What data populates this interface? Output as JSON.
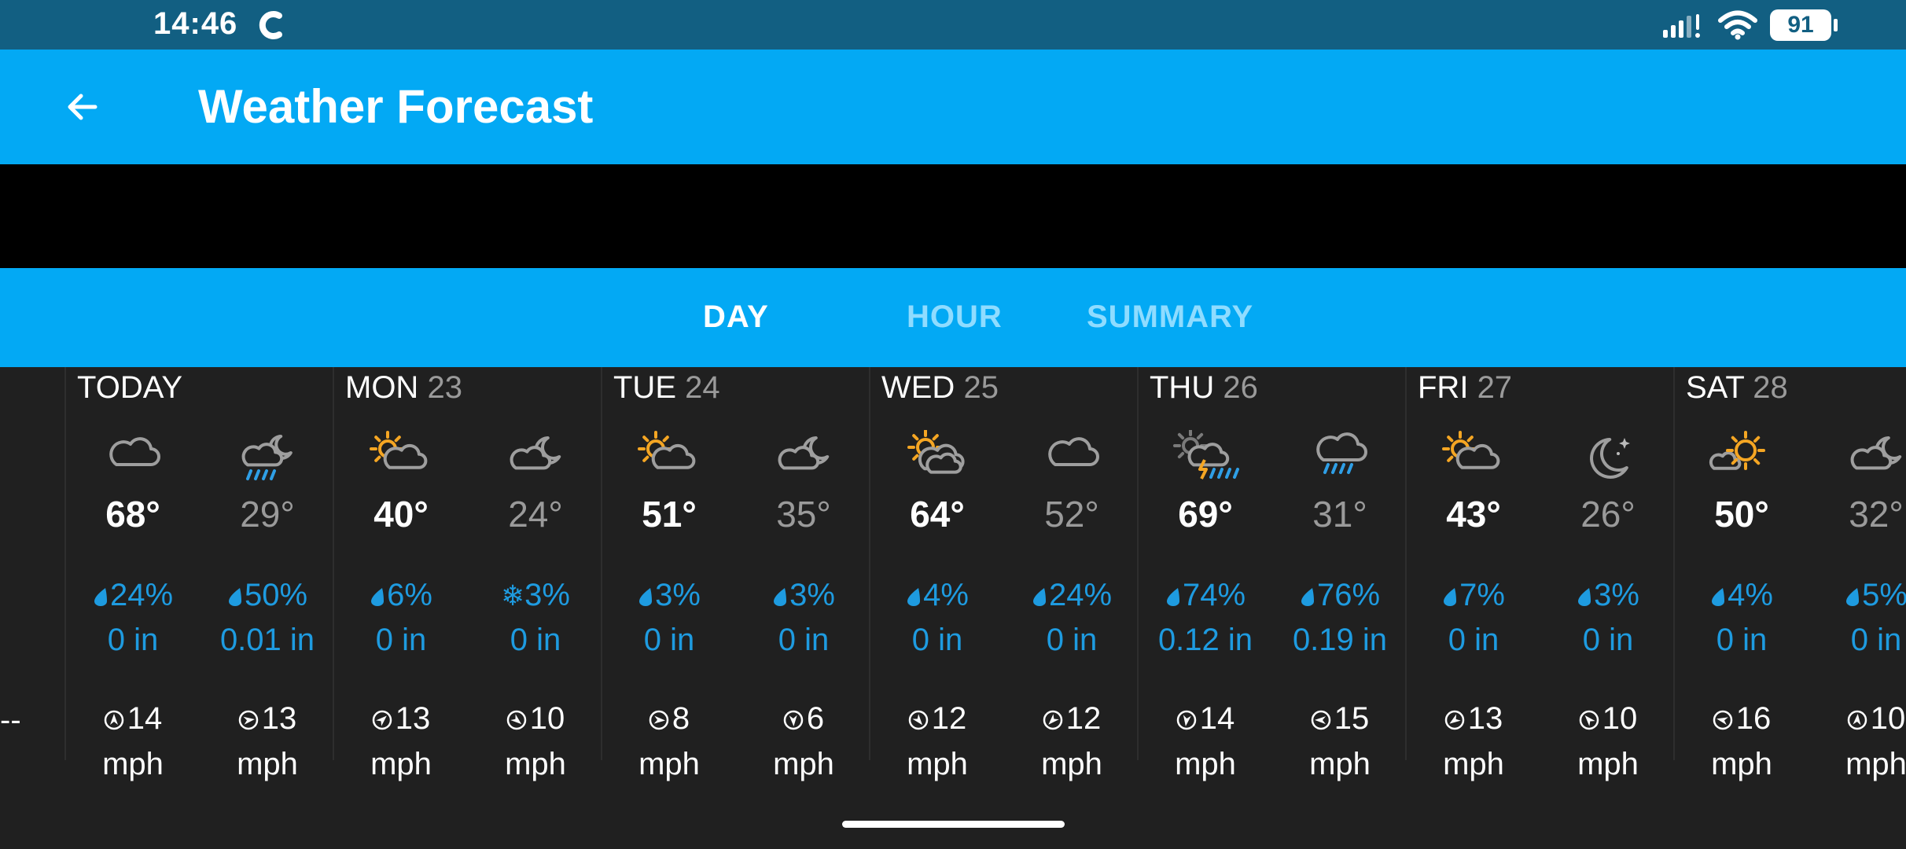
{
  "status": {
    "time": "14:46",
    "battery": "91"
  },
  "header": {
    "title": "Weather Forecast"
  },
  "tabs": [
    {
      "label": "DAY",
      "active": true
    },
    {
      "label": "HOUR",
      "active": false
    },
    {
      "label": "SUMMARY",
      "active": false
    }
  ],
  "left_value": "--",
  "days": [
    {
      "name": "TODAY",
      "date": "",
      "day": {
        "icon": "cloudy-icon",
        "temp": "68°",
        "precip": "24%",
        "precip_type": "rain",
        "amount": "0 in",
        "wind": "14",
        "wind_unit": "mph"
      },
      "night": {
        "icon": "night-rain-icon",
        "temp": "29°",
        "precip": "50%",
        "precip_type": "rain",
        "amount": "0.01 in",
        "wind": "13",
        "wind_unit": "mph"
      }
    },
    {
      "name": "MON",
      "date": "23",
      "day": {
        "icon": "partly-sunny-icon",
        "temp": "40°",
        "precip": "6%",
        "precip_type": "rain",
        "amount": "0 in",
        "wind": "13",
        "wind_unit": "mph"
      },
      "night": {
        "icon": "night-cloudy-icon",
        "temp": "24°",
        "precip": "3%",
        "precip_type": "snow",
        "amount": "0 in",
        "wind": "10",
        "wind_unit": "mph"
      }
    },
    {
      "name": "TUE",
      "date": "24",
      "day": {
        "icon": "partly-sunny-icon",
        "temp": "51°",
        "precip": "3%",
        "precip_type": "rain",
        "amount": "0 in",
        "wind": "8",
        "wind_unit": "mph"
      },
      "night": {
        "icon": "night-cloudy-icon",
        "temp": "35°",
        "precip": "3%",
        "precip_type": "rain",
        "amount": "0 in",
        "wind": "6",
        "wind_unit": "mph"
      }
    },
    {
      "name": "WED",
      "date": "25",
      "day": {
        "icon": "mostly-cloudy-sun-icon",
        "temp": "64°",
        "precip": "4%",
        "precip_type": "rain",
        "amount": "0 in",
        "wind": "12",
        "wind_unit": "mph"
      },
      "night": {
        "icon": "cloudy-icon",
        "temp": "52°",
        "precip": "24%",
        "precip_type": "rain",
        "amount": "0 in",
        "wind": "12",
        "wind_unit": "mph"
      }
    },
    {
      "name": "THU",
      "date": "26",
      "day": {
        "icon": "thunderstorm-icon",
        "temp": "69°",
        "precip": "74%",
        "precip_type": "rain",
        "amount": "0.12 in",
        "wind": "14",
        "wind_unit": "mph"
      },
      "night": {
        "icon": "rain-icon",
        "temp": "31°",
        "precip": "76%",
        "precip_type": "rain",
        "amount": "0.19 in",
        "wind": "15",
        "wind_unit": "mph"
      }
    },
    {
      "name": "FRI",
      "date": "27",
      "day": {
        "icon": "partly-sunny-icon",
        "temp": "43°",
        "precip": "7%",
        "precip_type": "rain",
        "amount": "0 in",
        "wind": "13",
        "wind_unit": "mph"
      },
      "night": {
        "icon": "clear-night-icon",
        "temp": "26°",
        "precip": "3%",
        "precip_type": "rain",
        "amount": "0 in",
        "wind": "10",
        "wind_unit": "mph"
      }
    },
    {
      "name": "SAT",
      "date": "28",
      "day": {
        "icon": "sunny-icon",
        "temp": "50°",
        "precip": "4%",
        "precip_type": "rain",
        "amount": "0 in",
        "wind": "16",
        "wind_unit": "mph"
      },
      "night": {
        "icon": "night-cloudy-icon",
        "temp": "32°",
        "precip": "5%",
        "precip_type": "rain",
        "amount": "0 in",
        "wind": "10",
        "wind_unit": "mph"
      }
    }
  ],
  "colors": {
    "status_bar": "#125f82",
    "app_bar": "#03a9f4",
    "accent_precip": "#1e9be0",
    "background": "#202020"
  }
}
